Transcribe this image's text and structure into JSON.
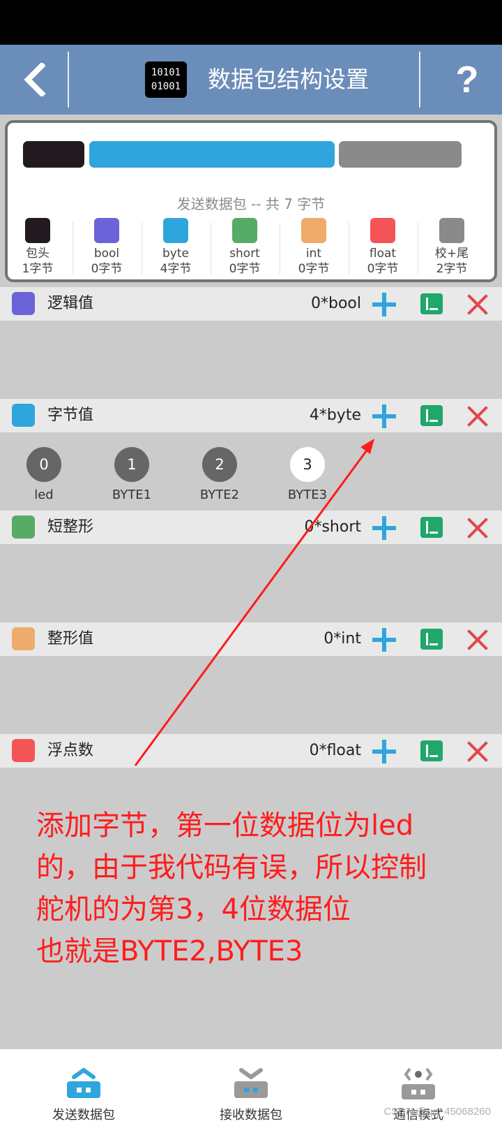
{
  "header": {
    "title": "数据包结构设置",
    "logo_line1": "10101",
    "logo_line2": "01001",
    "help_label": "?"
  },
  "summary": {
    "title": "发送数据包 -- 共 7 字节",
    "segments": [
      {
        "color": "#221a1f"
      },
      {
        "color": "#2ea6dd"
      },
      {
        "color": "#8a8a8a"
      }
    ],
    "types": [
      {
        "name": "包头",
        "count": "1字节",
        "color": "#221a1f"
      },
      {
        "name": "bool",
        "count": "0字节",
        "color": "#6a64d8"
      },
      {
        "name": "byte",
        "count": "4字节",
        "color": "#2ea6dd"
      },
      {
        "name": "short",
        "count": "0字节",
        "color": "#56ab67"
      },
      {
        "name": "int",
        "count": "0字节",
        "color": "#efab6c"
      },
      {
        "name": "float",
        "count": "0字节",
        "color": "#f55457"
      },
      {
        "name": "校+尾",
        "count": "2字节",
        "color": "#8a8a8a"
      }
    ]
  },
  "fields": [
    {
      "label": "逻辑值",
      "count": "0*bool",
      "color": "#6a64d8"
    },
    {
      "label": "字节值",
      "count": "4*byte",
      "color": "#2ea6dd"
    },
    {
      "label": "短整形",
      "count": "0*short",
      "color": "#56ab67"
    },
    {
      "label": "整形值",
      "count": "0*int",
      "color": "#efab6c"
    },
    {
      "label": "浮点数",
      "count": "0*float",
      "color": "#f55457"
    }
  ],
  "byte_items": [
    {
      "index": "0",
      "label": "led",
      "selected": false
    },
    {
      "index": "1",
      "label": "BYTE1",
      "selected": false
    },
    {
      "index": "2",
      "label": "BYTE2",
      "selected": false
    },
    {
      "index": "3",
      "label": "BYTE3",
      "selected": true
    }
  ],
  "annotation": {
    "lines": [
      "添加字节，第一位数据位为led",
      "的，由于我代码有误，所以控制",
      "舵机的为第3，4位数据位",
      "也就是BYTE2,BYTE3"
    ],
    "color": "#ff1c1c"
  },
  "bottom_nav": {
    "items": [
      {
        "label": "发送数据包",
        "active": true
      },
      {
        "label": "接收数据包",
        "active": false
      },
      {
        "label": "通信模式",
        "active": false
      }
    ]
  },
  "watermark": "CSDN @qq_45068260"
}
